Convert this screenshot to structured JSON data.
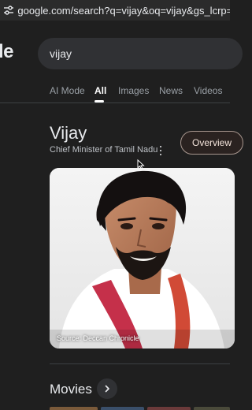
{
  "browser": {
    "url": "google.com/search?q=vijay&oq=vijay&gs_lcrp=EgZjaHJvb"
  },
  "google": {
    "logo_fragment": "le"
  },
  "search": {
    "value": "vijay"
  },
  "tabs": [
    {
      "label": "AI Mode",
      "active": false
    },
    {
      "label": "All",
      "active": true
    },
    {
      "label": "Images",
      "active": false
    },
    {
      "label": "News",
      "active": false
    },
    {
      "label": "Videos",
      "active": false
    }
  ],
  "knowledge_panel": {
    "title": "Vijay",
    "subtitle": "Chief Minister of Tamil Nadu",
    "overview_label": "Overview",
    "image_source": "Source: Deccan Chronicle"
  },
  "movies": {
    "heading": "Movies"
  },
  "colors": {
    "background": "#1f1f1f",
    "search_box": "#303134",
    "chip_border": "#a8978f",
    "text_primary": "#e8eaed",
    "text_secondary": "#9aa0a6"
  },
  "icons": {
    "address_bar": "tune-icon",
    "kp_menu": "more-vert-icon",
    "movies_nav": "chevron-right-icon",
    "pointer": "mouse-cursor-icon"
  }
}
